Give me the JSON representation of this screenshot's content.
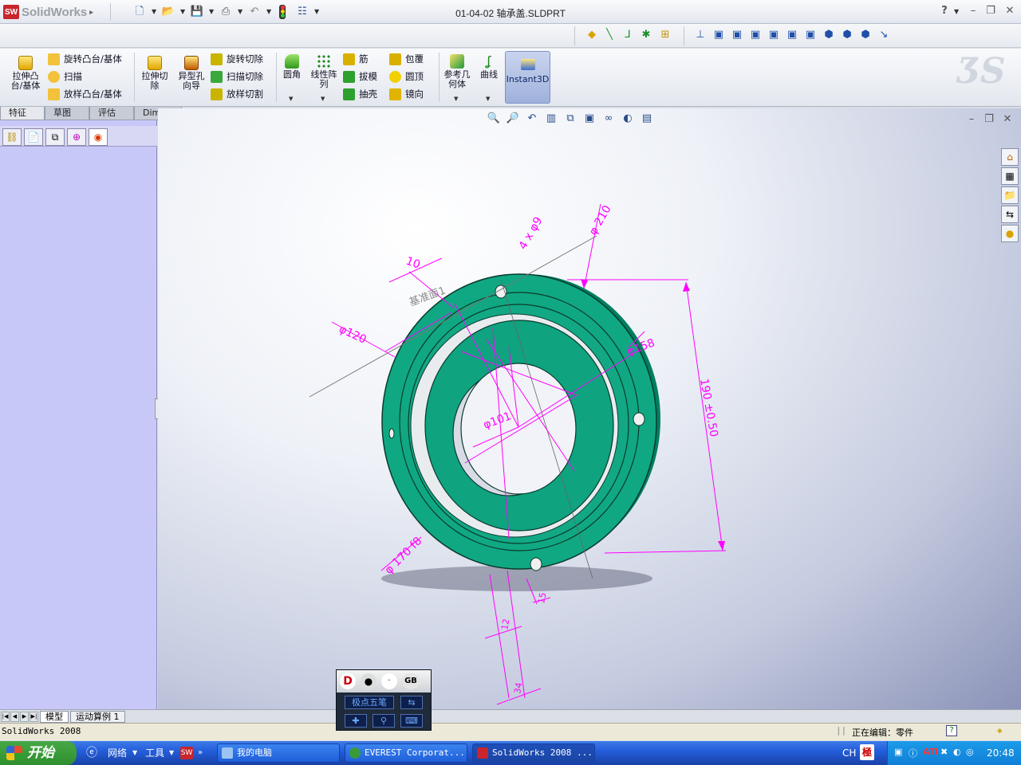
{
  "app": {
    "logo_text": "SolidWorks",
    "logo_badge": "SW",
    "document_title": "01-04-02 轴承盖.SLDPRT",
    "help_icon": "?"
  },
  "quick_access": [
    "new-icon",
    "open-icon",
    "save-icon",
    "print-icon",
    "undo-icon",
    "rebuild-icon",
    "options-icon"
  ],
  "command_manager": {
    "col1": [
      {
        "label": "拉伸凸\n台/基体",
        "icon": "extrude-boss-icon"
      }
    ],
    "col2": [
      {
        "label": "旋转凸台/基体",
        "icon": "revolve-boss-icon"
      },
      {
        "label": "扫描",
        "icon": "sweep-icon"
      },
      {
        "label": "放样凸台/基体",
        "icon": "loft-icon"
      }
    ],
    "col3": [
      {
        "label": "拉伸切\n除",
        "icon": "extrude-cut-icon"
      },
      {
        "label": "异型孔\n向导",
        "icon": "hole-wizard-icon"
      }
    ],
    "col4": [
      {
        "label": "旋转切除",
        "icon": "revolve-cut-icon"
      },
      {
        "label": "扫描切除",
        "icon": "sweep-cut-icon"
      },
      {
        "label": "放样切割",
        "icon": "loft-cut-icon"
      }
    ],
    "col5": [
      {
        "label": "圆角",
        "icon": "fillet-icon"
      },
      {
        "label": "线性阵\n列",
        "icon": "linear-pattern-icon"
      }
    ],
    "col6": [
      {
        "label": "筋",
        "icon": "rib-icon"
      },
      {
        "label": "拔模",
        "icon": "draft-icon"
      },
      {
        "label": "抽壳",
        "icon": "shell-icon"
      }
    ],
    "col7": [
      {
        "label": "包覆",
        "icon": "wrap-icon"
      },
      {
        "label": "圆顶",
        "icon": "dome-icon"
      },
      {
        "label": "镜向",
        "icon": "mirror-icon"
      }
    ],
    "col8": [
      {
        "label": "参考几\n何体",
        "icon": "reference-geometry-icon"
      },
      {
        "label": "曲线",
        "icon": "curves-icon"
      }
    ],
    "instant3d": "Instant3D"
  },
  "tabs": [
    "特征",
    "草图",
    "评估",
    "DimXpert"
  ],
  "bottom_tabs": [
    "模型",
    "运动算例 1"
  ],
  "status": {
    "left": "SolidWorks 2008",
    "editing": "正在编辑：零件"
  },
  "annotations": {
    "dia9": "4 x φ9",
    "dia210": "φ 210",
    "d10": "10",
    "plane": "基准面1",
    "dia120": "φ120",
    "dia158": "φ158",
    "dia101": "φ101",
    "d190": "190 ±0.50",
    "dia170": "φ 170 f8",
    "d12": "12",
    "d15": "15",
    "d34": "34"
  },
  "ime": {
    "label": "极点五笔",
    "gb": "GB"
  },
  "taskbar": {
    "start": "开始",
    "network": "网络",
    "tools": "工具",
    "items": [
      "我的电脑",
      "EVEREST Corporat...",
      "SolidWorks 2008 ..."
    ],
    "lang": "CH",
    "time": "20:48"
  },
  "colors": {
    "part": "#0aa07c",
    "dimension": "#ff00ff",
    "left_pane": "#c8c8f8"
  }
}
